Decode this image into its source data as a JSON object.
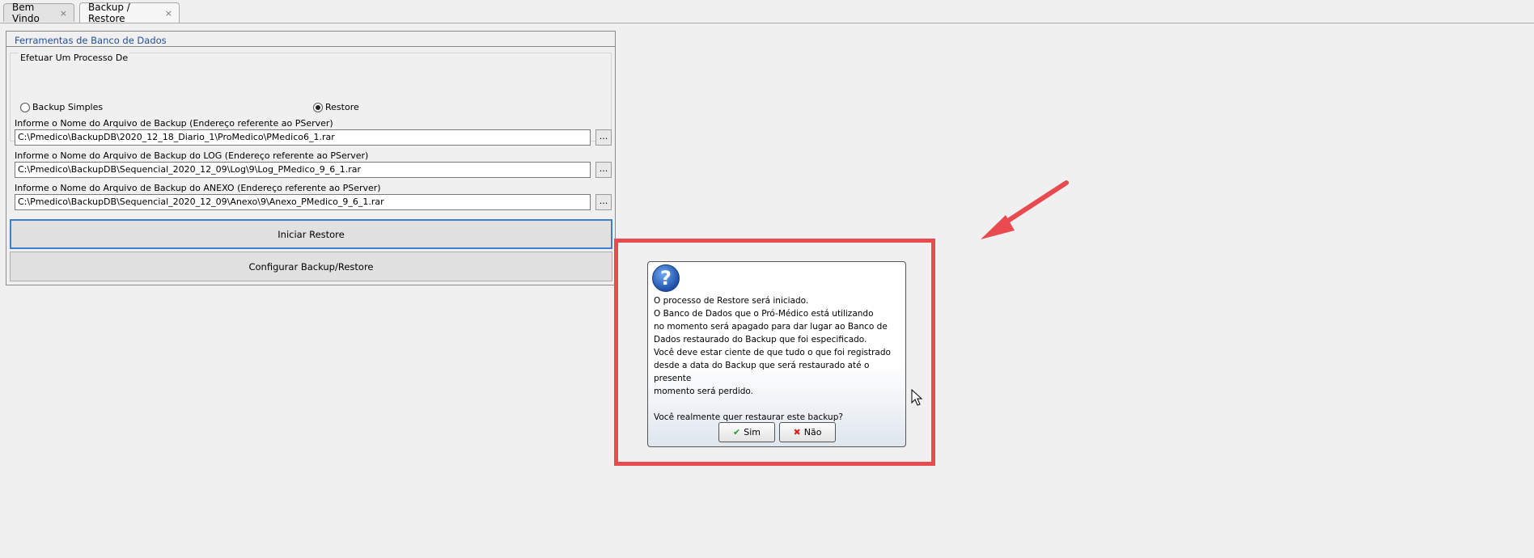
{
  "tabs": [
    {
      "label": "Bem Vindo",
      "close": "×"
    },
    {
      "label": "Backup / Restore",
      "close": "×"
    }
  ],
  "panel": {
    "title": "Ferramentas de Banco de Dados",
    "group_title": "Efetuar Um Processo De",
    "radio_backup": "Backup Simples",
    "radio_restore": "Restore",
    "selected": "Restore",
    "fields": [
      {
        "label": "Informe o Nome do Arquivo de Backup (Endereço referente ao PServer)",
        "value": "C:\\Pmedico\\BackupDB\\2020_12_18_Diario_1\\ProMedico\\PMedico6_1.rar"
      },
      {
        "label": "Informe o Nome do Arquivo de Backup do LOG (Endereço referente ao PServer)",
        "value": "C:\\Pmedico\\BackupDB\\Sequencial_2020_12_09\\Log\\9\\Log_PMedico_9_6_1.rar"
      },
      {
        "label": "Informe o Nome do Arquivo de Backup do ANEXO (Endereço referente ao PServer)",
        "value": "C:\\Pmedico\\BackupDB\\Sequencial_2020_12_09\\Anexo\\9\\Anexo_PMedico_9_6_1.rar"
      }
    ],
    "browse_label": "...",
    "start_button": "Iniciar Restore",
    "config_button": "Configurar Backup/Restore"
  },
  "dialog": {
    "icon": "question-icon",
    "message": "O processo de Restore será iniciado.\nO Banco de Dados que o Pró-Médico está utilizando\nno momento será apagado para dar lugar ao Banco de\nDados restaurado do Backup que foi especificado.\nVocê deve estar ciente de que tudo o que foi registrado\ndesde a data do Backup que será restaurado até o presente\nmomento será perdido.\n\nVocê realmente quer restaurar este backup?",
    "yes_label": "Sim",
    "no_label": "Não"
  },
  "colors": {
    "annotation": "#e84a4f",
    "panel_title": "#1f4e9a",
    "focus": "#3c7fd1"
  }
}
